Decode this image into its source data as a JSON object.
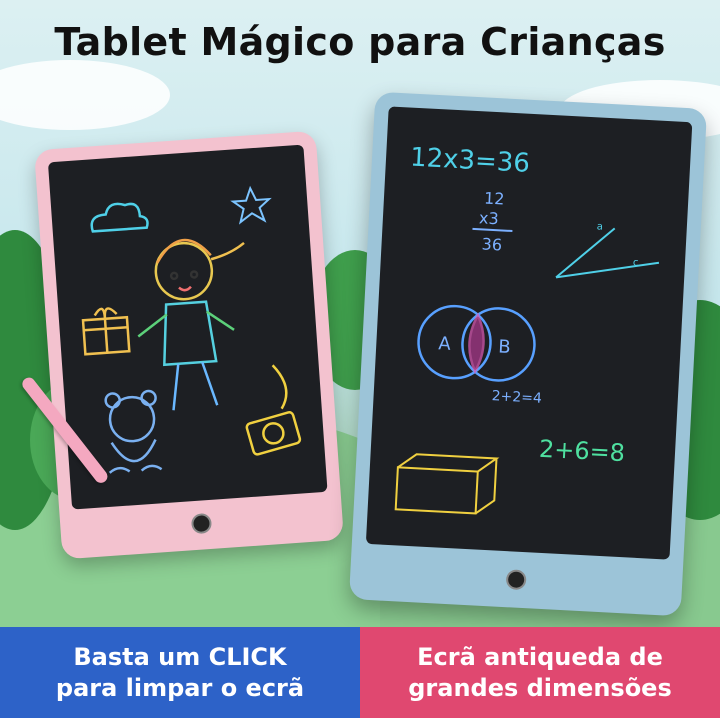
{
  "title": "Tablet Mágico para Crianças",
  "left_banner": {
    "line1": "Basta um CLICK",
    "line2": "para limpar o ecrã",
    "color": "#2d62c8"
  },
  "right_banner": {
    "line1": "Ecrã antiqueda de",
    "line2": "grandes dimensões",
    "color": "#e04870"
  },
  "right_screen_math": {
    "eq1": "12x3=36",
    "mult_top": "12",
    "mult_mid": "x3",
    "mult_res": "36",
    "set_a": "A",
    "set_b": "B",
    "eq2": "2+2=4",
    "eq3": "2+6=8",
    "angle_a": "a",
    "angle_c": "c"
  },
  "icons": [
    "cloud-icon",
    "star-icon",
    "girl-drawing",
    "gift-icon",
    "teddy-bear-icon",
    "camera-icon",
    "power-button-icon"
  ],
  "colors": {
    "left_tablet": "#f3c2cf",
    "right_tablet": "#9cc4d8"
  }
}
